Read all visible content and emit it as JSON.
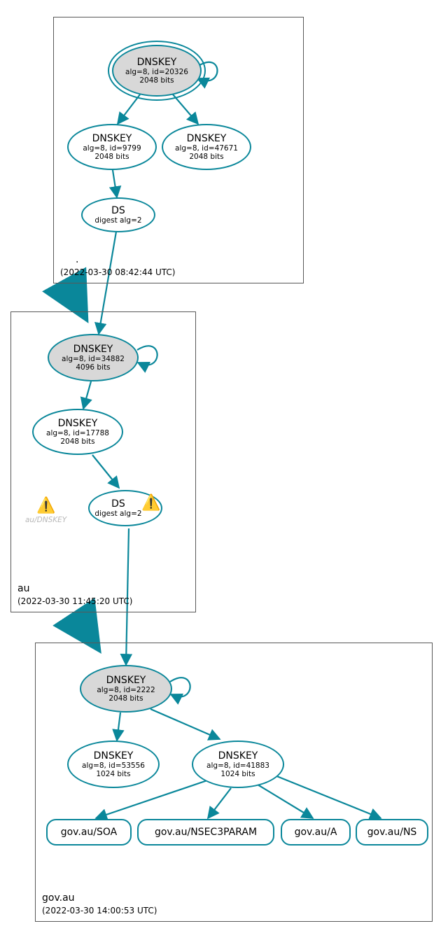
{
  "zones": {
    "root": {
      "label": ".",
      "timestamp": "(2022-03-30 08:42:44 UTC)"
    },
    "au": {
      "label": "au",
      "timestamp": "(2022-03-30 11:45:20 UTC)"
    },
    "govau": {
      "label": "gov.au",
      "timestamp": "(2022-03-30 14:00:53 UTC)"
    }
  },
  "nodes": {
    "root_ksk": {
      "title": "DNSKEY",
      "line1": "alg=8, id=20326",
      "line2": "2048 bits"
    },
    "root_zsk": {
      "title": "DNSKEY",
      "line1": "alg=8, id=9799",
      "line2": "2048 bits"
    },
    "root_extra": {
      "title": "DNSKEY",
      "line1": "alg=8, id=47671",
      "line2": "2048 bits"
    },
    "root_ds": {
      "title": "DS",
      "line1": "digest alg=2"
    },
    "au_ksk": {
      "title": "DNSKEY",
      "line1": "alg=8, id=34882",
      "line2": "4096 bits"
    },
    "au_zsk": {
      "title": "DNSKEY",
      "line1": "alg=8, id=17788",
      "line2": "2048 bits"
    },
    "au_ds": {
      "title": "DS",
      "line1": "digest alg=2"
    },
    "au_dnskey_label": "au/DNSKEY",
    "gov_ksk": {
      "title": "DNSKEY",
      "line1": "alg=8, id=2222",
      "line2": "2048 bits"
    },
    "gov_zsk1": {
      "title": "DNSKEY",
      "line1": "alg=8, id=53556",
      "line2": "1024 bits"
    },
    "gov_zsk2": {
      "title": "DNSKEY",
      "line1": "alg=8, id=41883",
      "line2": "1024 bits"
    },
    "rec_soa": "gov.au/SOA",
    "rec_nsec3": "gov.au/NSEC3PARAM",
    "rec_a": "gov.au/A",
    "rec_ns": "gov.au/NS"
  }
}
